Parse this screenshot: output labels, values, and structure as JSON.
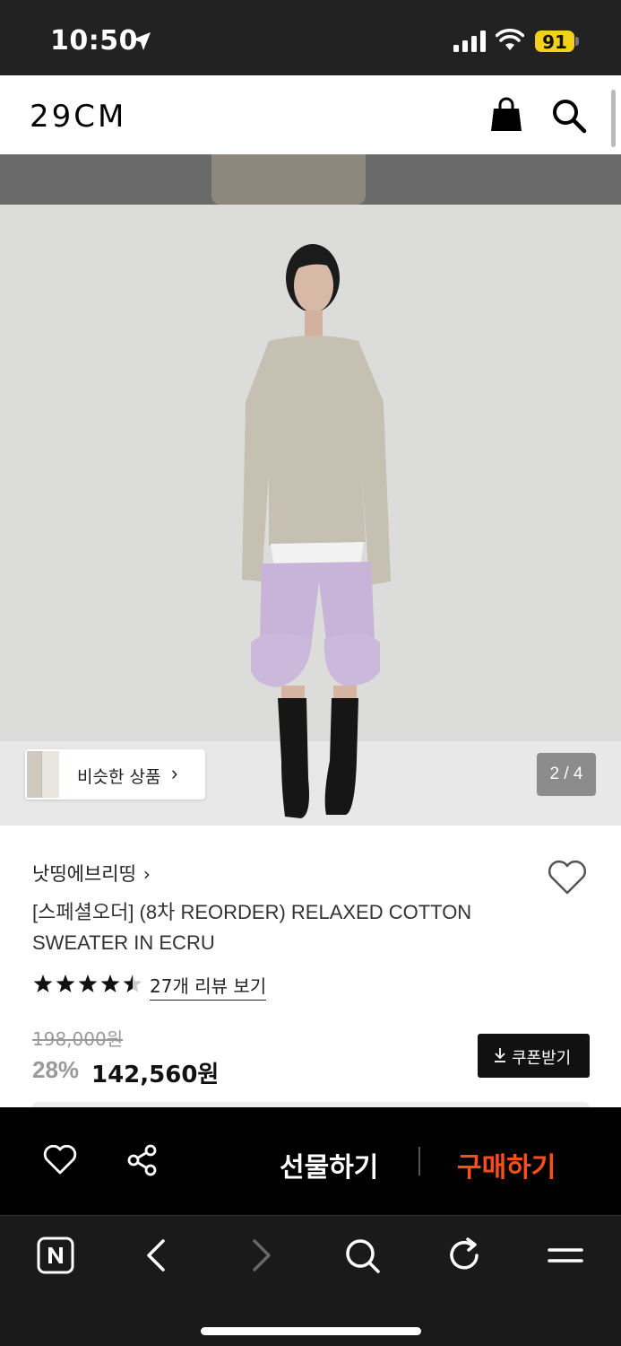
{
  "status_bar": {
    "time": "10:50",
    "battery": "91"
  },
  "header": {
    "logo": "29CM"
  },
  "gallery": {
    "similar_label": "비슷한 상품",
    "similar_chevron": "›",
    "page_counter": "2 / 4"
  },
  "product": {
    "brand": "낫띵에브리띵",
    "brand_chevron": "›",
    "title": "[스페셜오더] (8차 REORDER) RELAXED COTTON SWEATER IN ECRU",
    "rating": 4.5,
    "review_link": "27개 리뷰 보기",
    "original_price": "198,000원",
    "discount": "28%",
    "sale_price": "142,560원",
    "coupon_label": "쿠폰받기"
  },
  "action_bar": {
    "gift_label": "선물하기",
    "buy_label": "구매하기"
  },
  "colors": {
    "buy_accent": "#ff4c1b",
    "battery": "#f2d11a",
    "status_bg": "#222222"
  },
  "icons": [
    "location-arrow-icon",
    "signal-icon",
    "wifi-icon",
    "shopping-bag-icon",
    "search-icon",
    "heart-icon",
    "share-icon",
    "naver-icon",
    "back-icon",
    "forward-icon",
    "find-icon",
    "reload-icon",
    "menu-icon",
    "download-icon"
  ]
}
